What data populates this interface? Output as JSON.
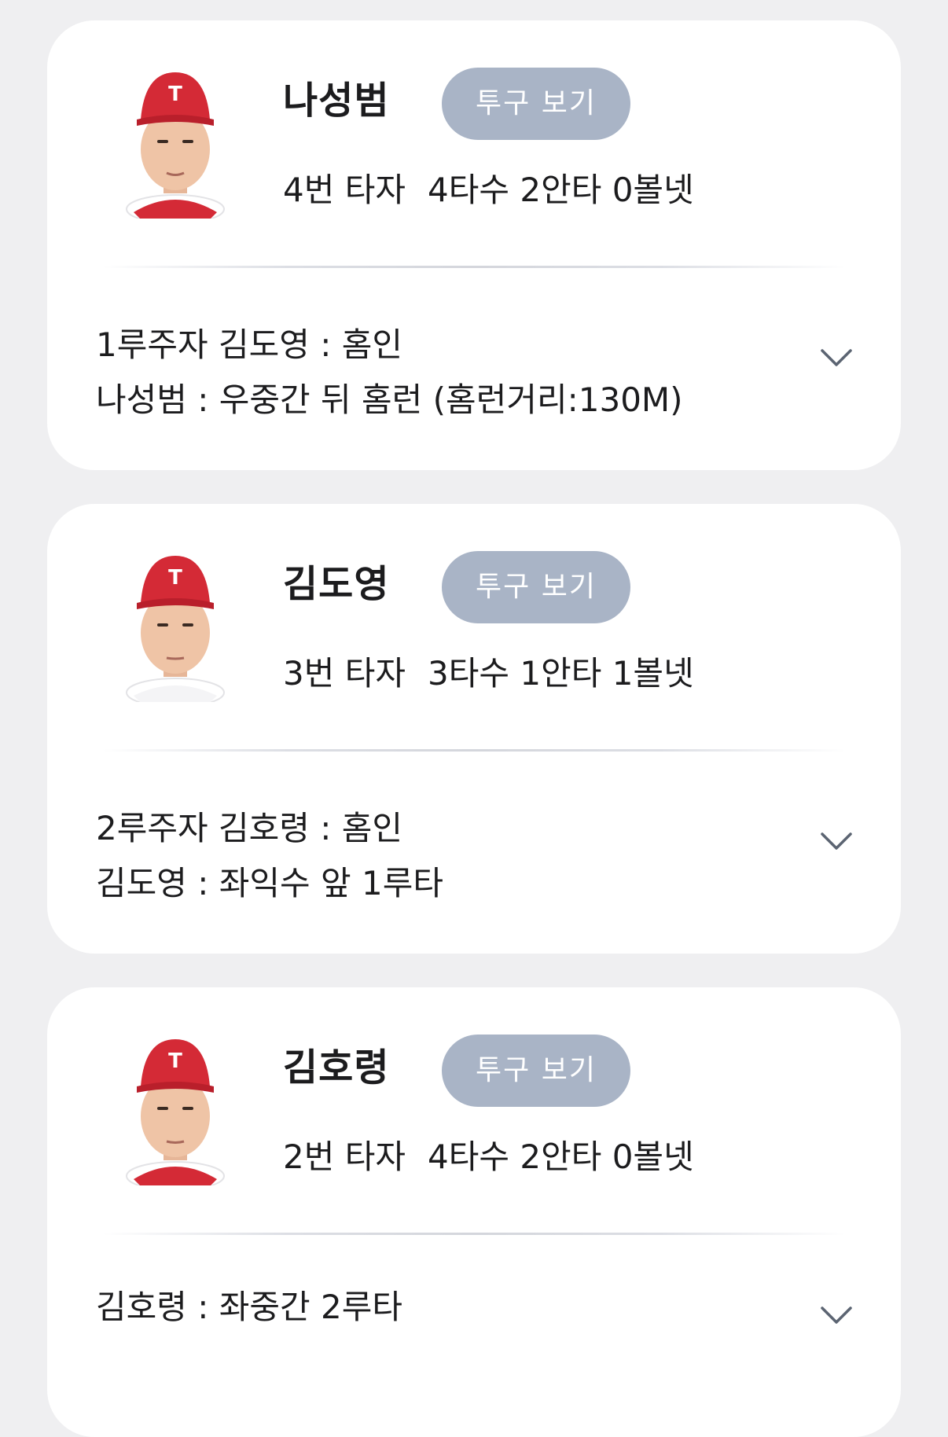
{
  "accent": {
    "button_bg": "#a9b4c6",
    "card_bg": "#ffffff",
    "page_bg": "#efeff1",
    "cap_red": "#d42a36"
  },
  "players": [
    {
      "name": "나성범",
      "button_label": "투구 보기",
      "batting_order": "4번 타자",
      "line": "4타수 2안타 0볼넷",
      "plays": [
        "1루주자 김도영 : 홈인",
        "나성범 : 우중간 뒤 홈런 (홈런거리:130M)"
      ],
      "expand_icon": "chevron-down-icon"
    },
    {
      "name": "김도영",
      "button_label": "투구 보기",
      "batting_order": "3번 타자",
      "line": "3타수 1안타 1볼넷",
      "plays": [
        "2루주자 김호령 : 홈인",
        "김도영 : 좌익수 앞 1루타"
      ],
      "expand_icon": "chevron-down-icon"
    },
    {
      "name": "김호령",
      "button_label": "투구 보기",
      "batting_order": "2번 타자",
      "line": "4타수 2안타 0볼넷",
      "plays": [
        "김호령 : 좌중간 2루타"
      ],
      "expand_icon": "chevron-down-icon"
    }
  ]
}
